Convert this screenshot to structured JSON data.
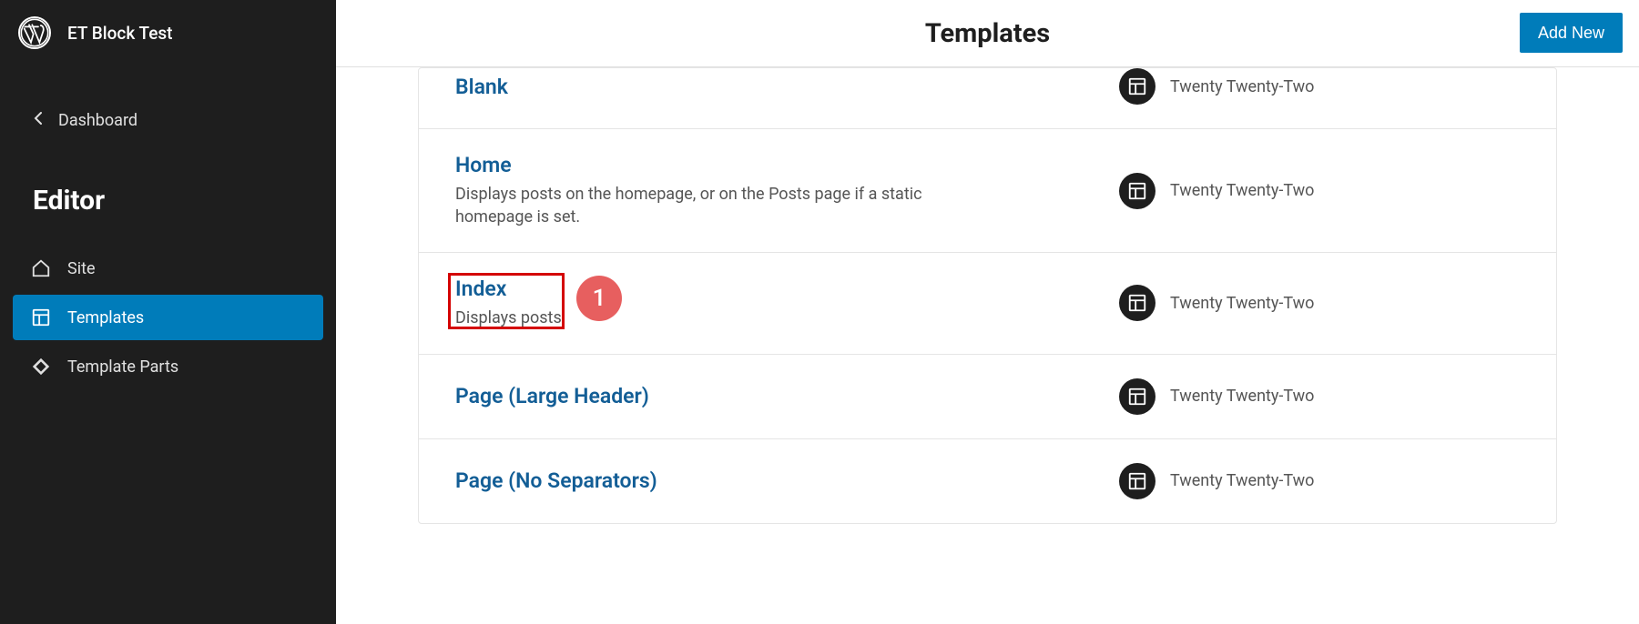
{
  "site_title": "ET Block Test",
  "dashboard_label": "Dashboard",
  "editor_heading": "Editor",
  "nav": {
    "site": "Site",
    "templates": "Templates",
    "template_parts": "Template Parts"
  },
  "page_title": "Templates",
  "add_new_label": "Add New",
  "theme_name": "Twenty Twenty-Two",
  "templates": {
    "blank": {
      "title": "Blank",
      "description": ""
    },
    "home": {
      "title": "Home",
      "description": "Displays posts on the homepage, or on the Posts page if a static homepage is set."
    },
    "index": {
      "title": "Index",
      "description": "Displays posts."
    },
    "page_large_header": {
      "title": "Page (Large Header)",
      "description": ""
    },
    "page_no_separators": {
      "title": "Page (No Separators)",
      "description": ""
    }
  },
  "annotation": {
    "badge": "1"
  },
  "colors": {
    "sidebar_bg": "#1e1e1e",
    "accent": "#007cba",
    "link": "#135e96",
    "annot_border": "#d40000",
    "annot_badge": "#e75f5f"
  }
}
